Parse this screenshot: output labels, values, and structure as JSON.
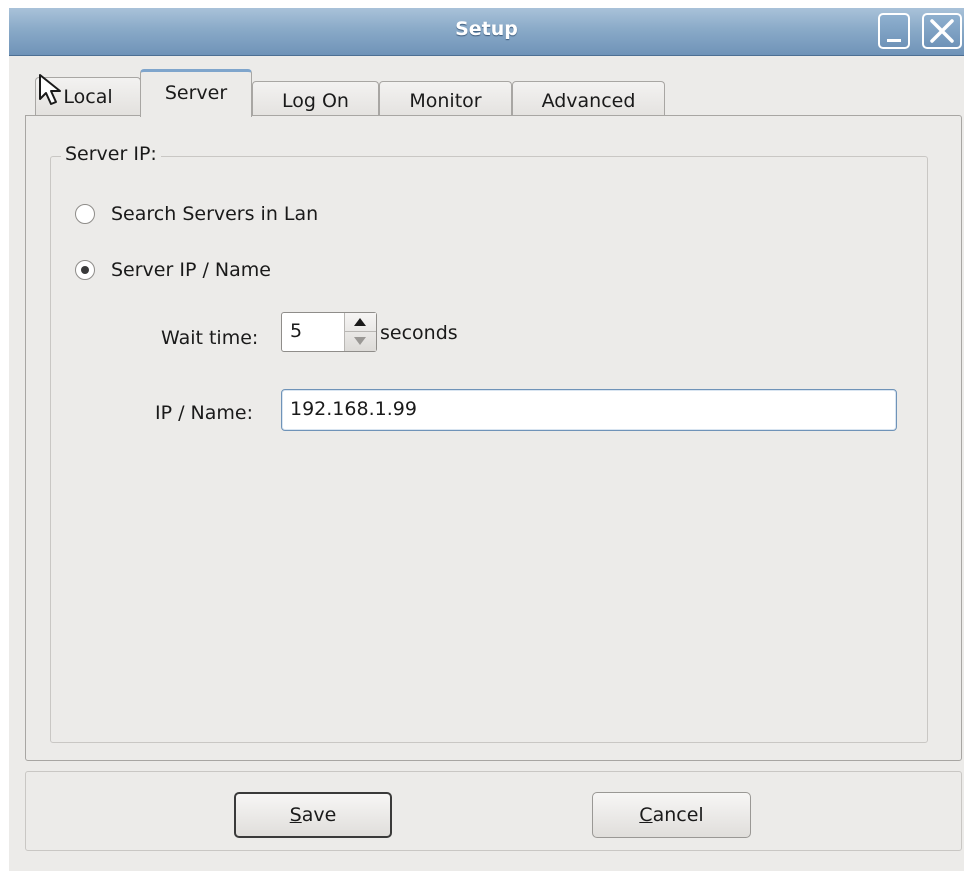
{
  "window": {
    "title": "Setup"
  },
  "tabs": [
    {
      "label": "Local",
      "active": false
    },
    {
      "label": "Server",
      "active": true
    },
    {
      "label": "Log On",
      "active": false
    },
    {
      "label": "Monitor",
      "active": false
    },
    {
      "label": "Advanced",
      "active": false
    }
  ],
  "server": {
    "group_title": "Server IP:",
    "radio_search_label": "Search Servers in Lan",
    "radio_search_checked": false,
    "radio_ip_label": "Server IP / Name",
    "radio_ip_checked": true,
    "wait_time_label": "Wait time:",
    "wait_time_value": "5",
    "wait_time_unit": "seconds",
    "ip_label": "IP / Name:",
    "ip_value": "192.168.1.99"
  },
  "buttons": {
    "save_mnemonic": "S",
    "save_rest": "ave",
    "cancel_mnemonic": "C",
    "cancel_rest": "ancel"
  },
  "colors": {
    "titlebar": "#8aaac8",
    "window_bg": "#ecebe9",
    "focus_border": "#6f93b8"
  },
  "icons": [
    "minimize-icon",
    "close-icon",
    "spin-up-icon",
    "spin-down-icon",
    "mouse-cursor-icon"
  ]
}
